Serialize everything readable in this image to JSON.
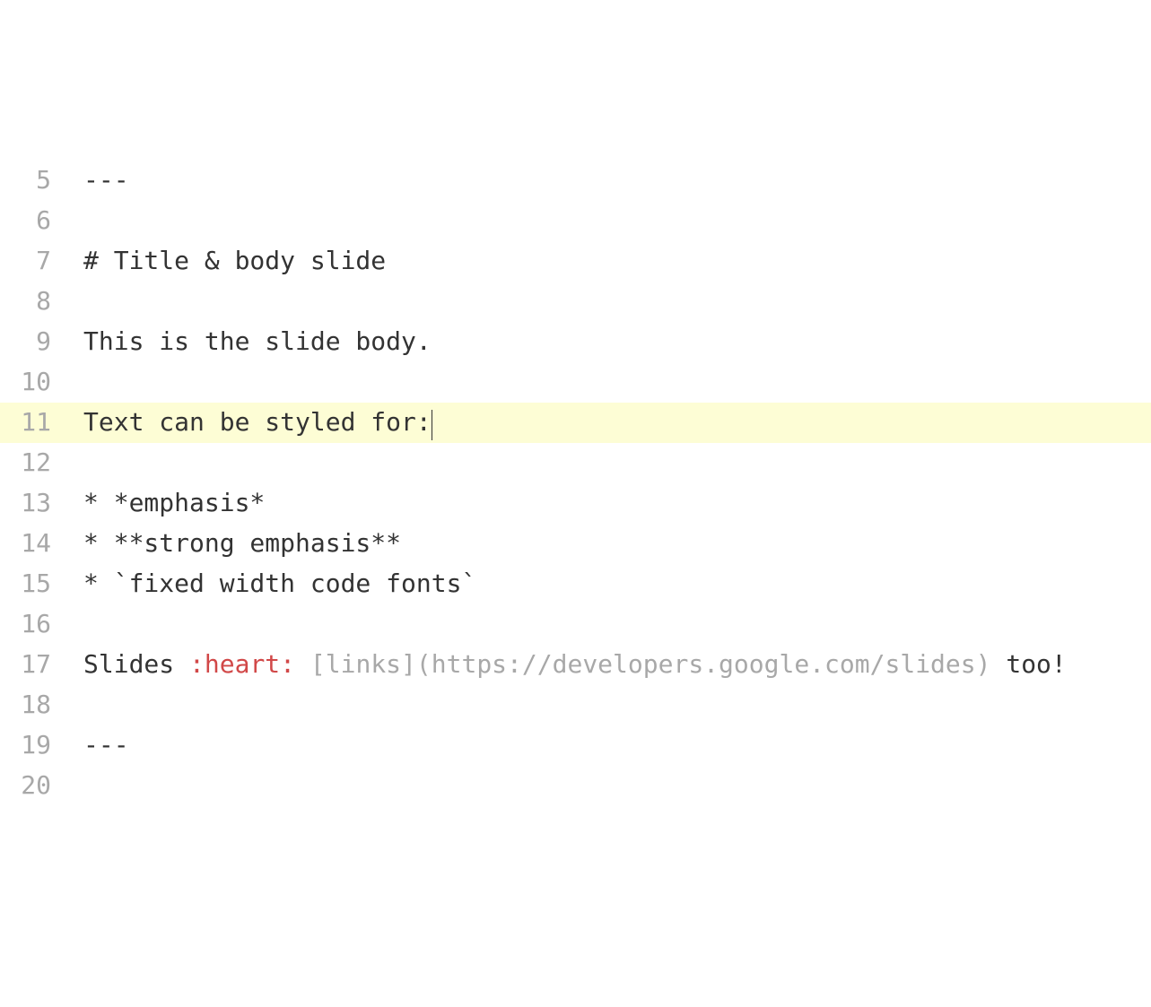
{
  "editor": {
    "active_line": 11,
    "lines": [
      {
        "number": 5,
        "tokens": [
          {
            "text": "---",
            "cls": "token-plain"
          }
        ]
      },
      {
        "number": 6,
        "tokens": []
      },
      {
        "number": 7,
        "tokens": [
          {
            "text": "# Title & body slide",
            "cls": "token-plain"
          }
        ]
      },
      {
        "number": 8,
        "tokens": []
      },
      {
        "number": 9,
        "tokens": [
          {
            "text": "This is the slide body.",
            "cls": "token-plain"
          }
        ]
      },
      {
        "number": 10,
        "tokens": []
      },
      {
        "number": 11,
        "tokens": [
          {
            "text": "Text can be styled for:",
            "cls": "token-plain"
          }
        ],
        "cursor_after": true
      },
      {
        "number": 12,
        "tokens": []
      },
      {
        "number": 13,
        "tokens": [
          {
            "text": "* *emphasis*",
            "cls": "token-plain"
          }
        ]
      },
      {
        "number": 14,
        "tokens": [
          {
            "text": "* **strong emphasis**",
            "cls": "token-plain"
          }
        ]
      },
      {
        "number": 15,
        "tokens": [
          {
            "text": "* `fixed width code fonts`",
            "cls": "token-plain"
          }
        ]
      },
      {
        "number": 16,
        "tokens": []
      },
      {
        "number": 17,
        "tokens": [
          {
            "text": "Slides ",
            "cls": "token-plain"
          },
          {
            "text": ":heart:",
            "cls": "token-red"
          },
          {
            "text": " ",
            "cls": "token-plain"
          },
          {
            "text": "[links](https://developers.google.com/slides)",
            "cls": "token-gray"
          },
          {
            "text": " too!",
            "cls": "token-plain"
          }
        ]
      },
      {
        "number": 18,
        "tokens": []
      },
      {
        "number": 19,
        "tokens": [
          {
            "text": "---",
            "cls": "token-plain"
          }
        ]
      },
      {
        "number": 20,
        "tokens": []
      }
    ]
  }
}
